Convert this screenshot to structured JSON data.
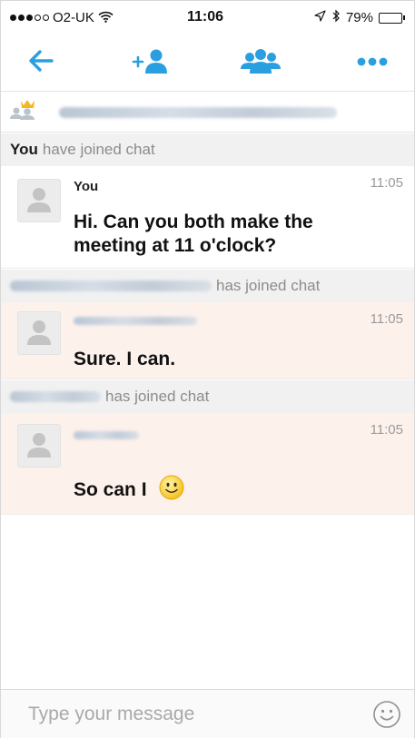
{
  "status_bar": {
    "carrier": "O2-UK",
    "time": "11:06",
    "battery_percent": "79%",
    "battery_level": 0.79,
    "signal_bars_filled": 3,
    "signal_bars_total": 5
  },
  "toolbar": {
    "back_icon": "arrow-left-icon",
    "add_participant_icon": "add-person-icon",
    "group_icon": "group-icon",
    "more_icon": "more-dots-icon",
    "accent_color": "#2a9fe0"
  },
  "participants_bar": {
    "icon": "crown-group-icon"
  },
  "system_messages": [
    {
      "bold": "You",
      "text": "have joined chat"
    },
    {
      "bold": "",
      "text": "has joined chat"
    },
    {
      "bold": "",
      "text": "has joined chat"
    }
  ],
  "messages": [
    {
      "sender": "You",
      "time": "11:05",
      "text_line1": "Hi. Can you both make the",
      "text_line2": "meeting at 11 o'clock?"
    },
    {
      "sender": "",
      "time": "11:05",
      "text": "Sure. I can."
    },
    {
      "sender": "",
      "time": "11:05",
      "text": "So can I"
    }
  ],
  "input": {
    "placeholder": "Type your message",
    "value": ""
  },
  "colors": {
    "other_message_bg": "#fdf1ec",
    "system_bg": "#f1f1f1"
  }
}
